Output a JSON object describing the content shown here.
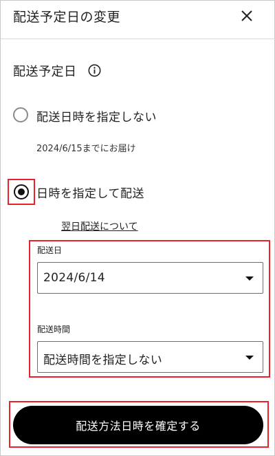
{
  "header": {
    "title": "配送予定日の変更",
    "close_icon": "close-icon"
  },
  "section": {
    "title": "配送予定日",
    "info_icon": "info-icon"
  },
  "options": [
    {
      "label": "配送日時を指定しない",
      "selected": false,
      "hint": "2024/6/15までにお届け"
    },
    {
      "label": "日時を指定して配送",
      "selected": true
    }
  ],
  "next_day_link": "翌日配送について",
  "delivery_date": {
    "label": "配送日",
    "value": "2024/6/14"
  },
  "delivery_time": {
    "label": "配送時間",
    "value": "配送時間を指定しない"
  },
  "confirm_button": "配送方法日時を確定する",
  "colors": {
    "highlight": "#e8222a",
    "button_bg": "#000000",
    "button_text": "#ffffff"
  }
}
